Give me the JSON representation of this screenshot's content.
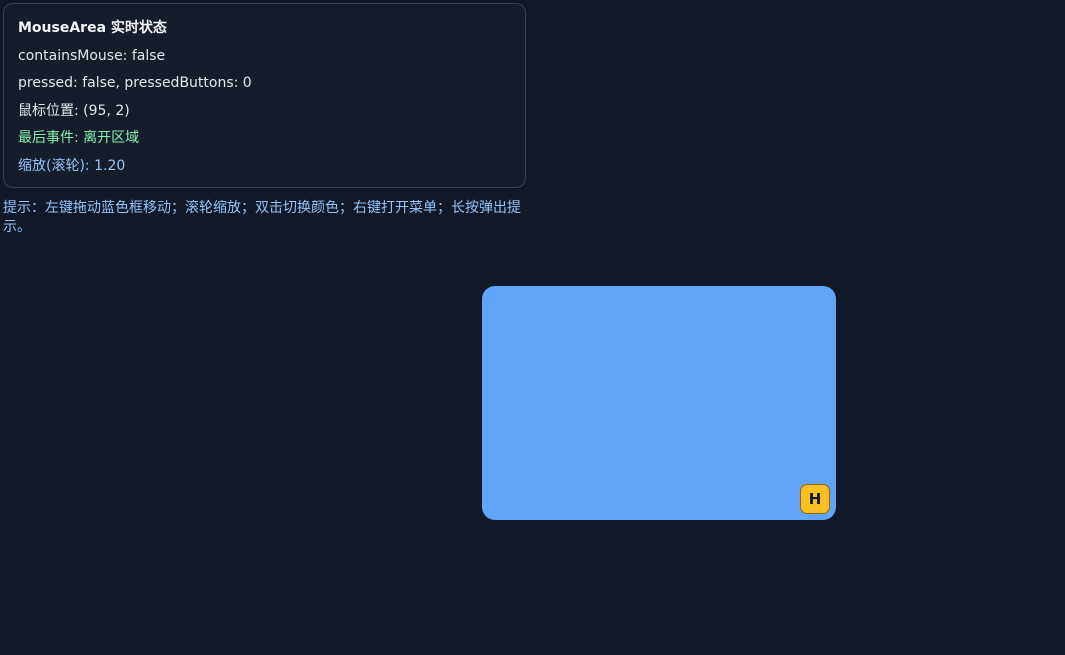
{
  "status_panel": {
    "title": "MouseArea 实时状态",
    "contains_mouse": "containsMouse: false",
    "pressed": "pressed: false, pressedButtons: 0",
    "mouse_position": "鼠标位置: (95, 2)",
    "last_event": "最后事件: 离开区域",
    "zoom": "缩放(滚轮): 1.20"
  },
  "hint": "提示：左键拖动蓝色框移动；滚轮缩放；双击切换颜色；右键打开菜单；长按弹出提示。",
  "draggable_box": {
    "color": "#60a5fa",
    "handle_label": "H",
    "handle_color": "#fbbf24"
  }
}
